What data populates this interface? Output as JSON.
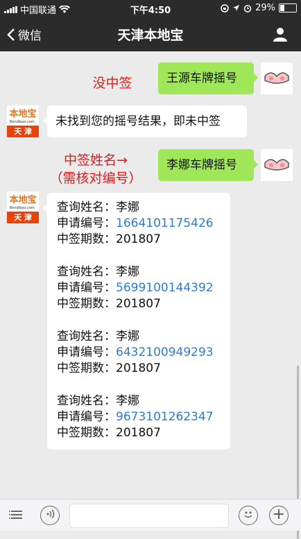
{
  "status_bar": {
    "carrier": "中国联通",
    "time": "下午4:50",
    "battery_percent": "29%",
    "battery_level": 0.29
  },
  "nav": {
    "back_label": "微信",
    "title": "天津本地宝"
  },
  "brand": {
    "logo_top": "本地宝",
    "logo_mini": "Bendibao.com",
    "logo_bottom": "天 津"
  },
  "annotations": {
    "first": "没中签",
    "second_line1": "中签姓名→",
    "second_line2": "（需核对编号）"
  },
  "messages": {
    "user_query_1": "王源车牌摇号",
    "bot_reply_1": "未找到您的摇号结果，即未中签",
    "user_query_2": "李娜车牌摇号",
    "results": [
      {
        "name_label": "查询姓名：",
        "name": "李娜",
        "code_label": "申请编号：",
        "code": "1664101175426",
        "period_label": "中签期数：",
        "period": "201807"
      },
      {
        "name_label": "查询姓名：",
        "name": "李娜",
        "code_label": "申请编号：",
        "code": "5699100144392",
        "period_label": "中签期数：",
        "period": "201807"
      },
      {
        "name_label": "查询姓名：",
        "name": "李娜",
        "code_label": "申请编号：",
        "code": "6432100949293",
        "period_label": "中签期数：",
        "period": "201807"
      },
      {
        "name_label": "查询姓名：",
        "name": "李娜",
        "code_label": "申请编号：",
        "code": "9673101262347",
        "period_label": "中签期数：",
        "period": "201807"
      }
    ]
  },
  "colors": {
    "user_bubble": "#9fe658",
    "link_number": "#2e7ad1",
    "annotation": "#e01a1a",
    "nav_bg": "#2b2b2b"
  }
}
